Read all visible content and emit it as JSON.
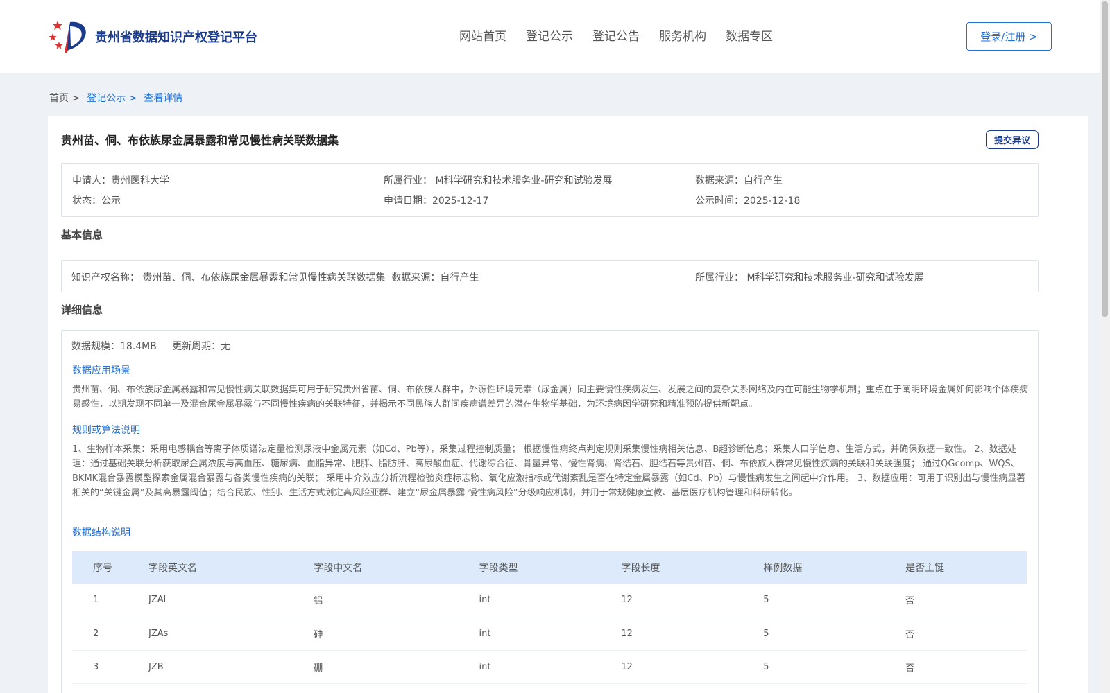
{
  "header": {
    "site_name": "贵州省数据知识产权登记平台",
    "nav": [
      "网站首页",
      "登记公示",
      "登记公告",
      "服务机构",
      "数据专区"
    ],
    "login_label": "登录/注册 >"
  },
  "breadcrumb": {
    "home": "首页 >",
    "publicity": "登记公示 >",
    "current": "查看详情"
  },
  "record": {
    "title": "贵州苗、侗、布依族尿金属暴露和常见慢性病关联数据集",
    "objection_label": "提交异议",
    "summary": {
      "applicant_label": "申请人：",
      "applicant": "贵州医科大学",
      "industry_label": "所属行业：",
      "industry": "M科学研究和技术服务业-研究和试验发展",
      "source_label": "数据来源：",
      "source": "自行产生",
      "status_label": "状态：",
      "status": "公示",
      "apply_date_label": "申请日期：",
      "apply_date": "2025-12-17",
      "publish_date_label": "公示时间：",
      "publish_date": "2025-12-18"
    },
    "basic": {
      "section_title": "基本信息",
      "ip_name_label": "知识产权名称：",
      "ip_name": "贵州苗、侗、布依族尿金属暴露和常见慢性病关联数据集",
      "source_label": "数据来源：",
      "source": "自行产生",
      "industry_label": "所属行业：",
      "industry": "M科学研究和技术服务业-研究和试验发展"
    },
    "detail": {
      "section_title": "详细信息",
      "scale_label": "数据规模：",
      "scale": "18.4MB",
      "cycle_label": "更新周期：",
      "cycle": "无",
      "scenario_title": "数据应用场景",
      "scenario_text": "贵州苗、侗、布依族尿金属暴露和常见慢性病关联数据集可用于研究贵州省苗、侗、布依族人群中，外源性环境元素（尿金属）同主要慢性疾病发生、发展之间的复杂关系网络及内在可能生物学机制；重点在于阐明环境金属如何影响个体疾病易感性，以期发现不同单一及混合尿金属暴露与不同慢性疾病的关联特征，并揭示不同民族人群间疾病谱差异的潜在生物学基础，为环境病因学研究和精准预防提供新靶点。",
      "algorithm_title": "规则或算法说明",
      "algorithm_text": "1、生物样本采集：采用电感耦合等离子体质谱法定量检测尿液中金属元素（如Cd、Pb等），采集过程控制质量； 根据慢性病终点判定规则采集慢性病相关信息、B超诊断信息；采集人口学信息、生活方式，并确保数据一致性。 2、数据处理：通过基础关联分析获取尿金属浓度与高血压、糖尿病、血脂异常、肥胖、脂肪肝、高尿酸血症、代谢综合征、骨量异常、慢性肾病、肾结石、胆结石等贵州苗、侗、布依族人群常见慢性疾病的关联和关联强度； 通过QGcomp、WQS、BKMK混合暴露模型探索金属混合暴露与各类慢性疾病的关联； 采用中介效应分析流程检验炎症标志物、氧化应激指标或代谢紊乱是否在特定金属暴露（如Cd、Pb）与慢性病发生之间起中介作用。 3、数据应用：可用于识别出与慢性病显著相关的“关键金属”及其高暴露阈值；结合民族、性别、生活方式划定高风险亚群、建立“尿金属暴露-慢性病风险”分级响应机制，并用于常规健康宣教、基层医疗机构管理和科研转化。",
      "structure_title": "数据结构说明",
      "table": {
        "headers": [
          "序号",
          "字段英文名",
          "字段中文名",
          "字段类型",
          "字段长度",
          "样例数据",
          "是否主键"
        ],
        "rows": [
          [
            "1",
            "JZAl",
            "铝",
            "int",
            "12",
            "5",
            "否"
          ],
          [
            "2",
            "JZAs",
            "砷",
            "int",
            "12",
            "5",
            "否"
          ],
          [
            "3",
            "JZB",
            "硼",
            "int",
            "12",
            "5",
            "否"
          ]
        ]
      }
    }
  },
  "colors": {
    "primary": "#1e6fd9",
    "brand": "#1a3a8c",
    "table_header_bg": "#dceafb",
    "page_bg": "#eef1f5"
  }
}
